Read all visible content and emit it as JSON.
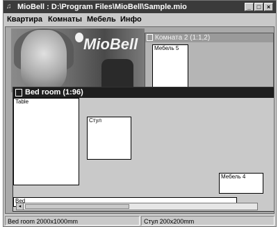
{
  "window": {
    "title": "MioBell : D:\\Program Files\\MioBell\\Sample.mio",
    "icon": "app-icon",
    "controls": [
      "minimize-icon",
      "maximize-icon",
      "close-icon"
    ]
  },
  "menu": {
    "items": [
      "Квартира",
      "Комнаты",
      "Мебель",
      "Инфо"
    ]
  },
  "logo": {
    "brand": "MioBell"
  },
  "room2": {
    "title": "Комната 2 (1:1,2)",
    "items": [
      {
        "label": "Мебель 5"
      }
    ]
  },
  "bedroom": {
    "title": "Bed room (1:96)",
    "items": [
      {
        "label": "Table"
      },
      {
        "label": "Стул"
      },
      {
        "label": "Мебель 4"
      },
      {
        "label": "Bed"
      }
    ]
  },
  "status": {
    "left": "Bed room 2000x1000mm",
    "right": "Стул 200x200mm"
  }
}
